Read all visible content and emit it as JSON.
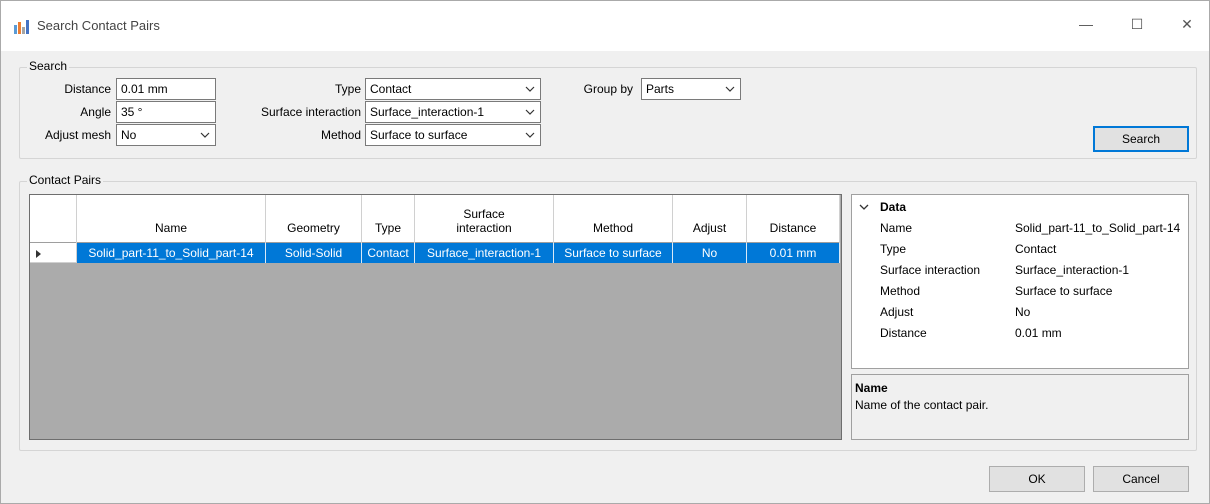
{
  "window": {
    "title": "Search Contact Pairs",
    "minimize": "—",
    "maximize": "☐",
    "close": "✕"
  },
  "search": {
    "group_label": "Search",
    "distance_label": "Distance",
    "distance_value": "0.01 mm",
    "angle_label": "Angle",
    "angle_value": "35 °",
    "adjust_mesh_label": "Adjust mesh",
    "adjust_mesh_value": "No",
    "type_label": "Type",
    "type_value": "Contact",
    "surface_interaction_label": "Surface interaction",
    "surface_interaction_value": "Surface_interaction-1",
    "method_label": "Method",
    "method_value": "Surface to surface",
    "group_by_label": "Group by",
    "group_by_value": "Parts",
    "search_button": "Search"
  },
  "contact_pairs": {
    "group_label": "Contact Pairs",
    "columns": [
      "Name",
      "Geometry",
      "Type",
      "Surface\ninteraction",
      "Method",
      "Adjust",
      "Distance"
    ],
    "rows": [
      [
        "Solid_part-11_to_Solid_part-14",
        "Solid-Solid",
        "Contact",
        "Surface_interaction-1",
        "Surface to surface",
        "No",
        "0.01 mm"
      ]
    ]
  },
  "properties": {
    "category": "Data",
    "items": [
      {
        "name": "Name",
        "value": "Solid_part-11_to_Solid_part-14"
      },
      {
        "name": "Type",
        "value": "Contact"
      },
      {
        "name": "Surface interaction",
        "value": "Surface_interaction-1"
      },
      {
        "name": "Method",
        "value": "Surface to surface"
      },
      {
        "name": "Adjust",
        "value": "No"
      },
      {
        "name": "Distance",
        "value": "0.01 mm"
      }
    ],
    "description_title": "Name",
    "description_text": "Name of the contact pair."
  },
  "footer": {
    "ok_button": "OK",
    "cancel_button": "Cancel"
  },
  "colors": {
    "selection": "#0078d7",
    "grid_background": "#ababab",
    "window_background": "#f0f0f0"
  }
}
